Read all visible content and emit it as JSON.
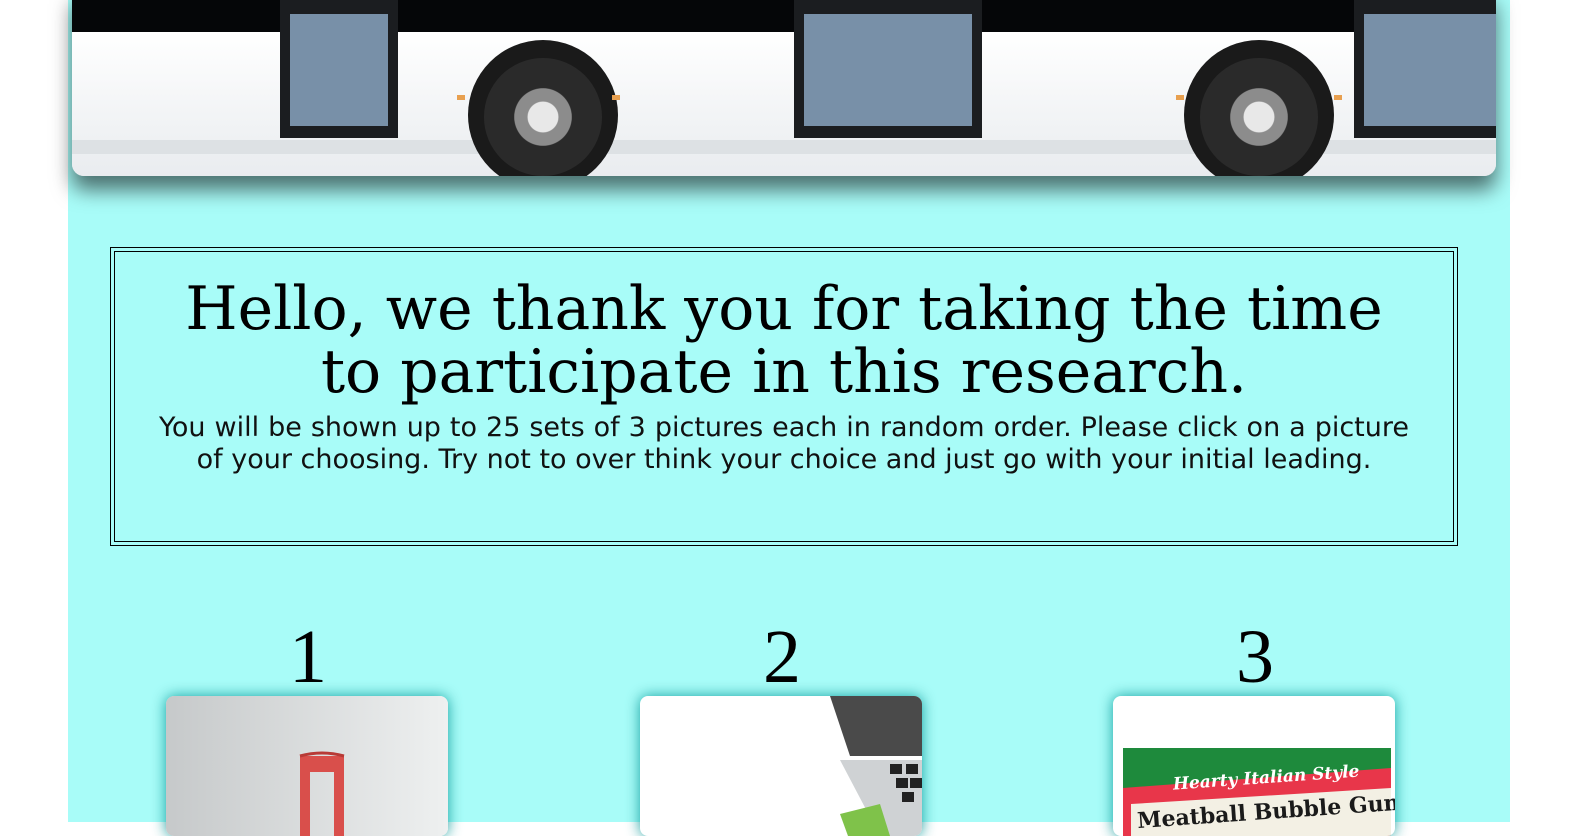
{
  "header": {
    "banner_image": "city bus side view"
  },
  "intro": {
    "title": "Hello, we thank you for taking the time to participate in this research.",
    "instructions": "You will be shown up to 25 sets of 3 pictures each in random order. Please click on a picture of your choosing. Try not to over think your choice and just go with your initial leading."
  },
  "choices": [
    {
      "number": "1",
      "image": "red chair"
    },
    {
      "number": "2",
      "image": "laptop keyboard"
    },
    {
      "number": "3",
      "image": "gum package",
      "package_line1": "Hearty Italian Style",
      "package_line2": "Meatball Bubble Gum"
    }
  ],
  "colors": {
    "panel_background": "#a8fcf8",
    "card_glow": "#00a0a0"
  }
}
